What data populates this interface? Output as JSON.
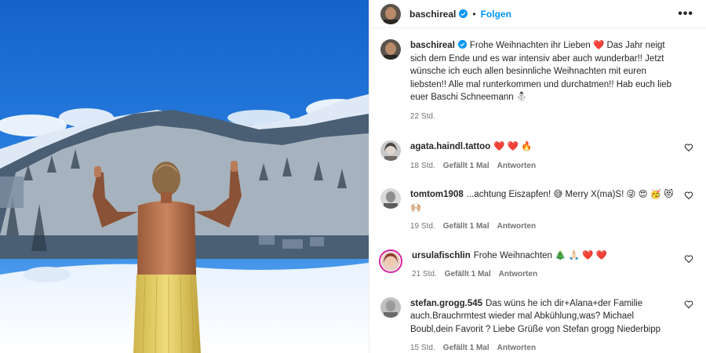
{
  "post": {
    "username": "baschireal",
    "dot": "•",
    "follow_label": "Folgen",
    "more_label": "•••"
  },
  "caption": {
    "username": "baschireal",
    "text": "Frohe Weihnachten ihr Lieben ❤️ Das Jahr neigt sich dem Ende und es war intensiv aber auch wunderbar!! Jetzt wünsche ich euch allen besinnliche Weihnachten mit euren liebsten!! Alle mal runterkommen und durchatmen!! Hab euch lieb euer Baschi Schneemann ⛄",
    "time": "22 Std."
  },
  "comments": [
    {
      "username": "agata.haindl.tattoo",
      "text": "❤️ ❤️ 🔥",
      "time": "18 Std.",
      "likes": "Gefällt 1 Mal",
      "reply": "Antworten"
    },
    {
      "username": "tomtom1908",
      "text": "...achtung Eiszapfen! 😅 Merry X(ma)S! 😜 😍 🥳 😻 🙌🏼",
      "time": "19 Std.",
      "likes": "Gefällt 1 Mal",
      "reply": "Antworten"
    },
    {
      "username": "ursulafischlin",
      "text": "Frohe Weihnachten 🎄 🙏🏻 ❤️ ❤️",
      "time": "21 Std.",
      "likes": "Gefällt 1 Mal",
      "reply": "Antworten"
    },
    {
      "username": "stefan.grogg.545",
      "text": "Das wüns he ich dir+Alana+der Familie auch.Brauchrmtest wieder mal Abkühlung,was? Michael Boubl,dein Favorit ? Liebe Grüße von Stefan grogg Niederbipp",
      "time": "15 Std.",
      "likes": "Gefällt 1 Mal",
      "reply": "Antworten"
    }
  ],
  "colors": {
    "accent": "#0095f6",
    "verified": "#0095f6",
    "secondary_text": "#737373"
  },
  "icons": {
    "verified": "verified-badge-icon",
    "more": "more-options-icon",
    "like": "heart-outline-icon"
  }
}
